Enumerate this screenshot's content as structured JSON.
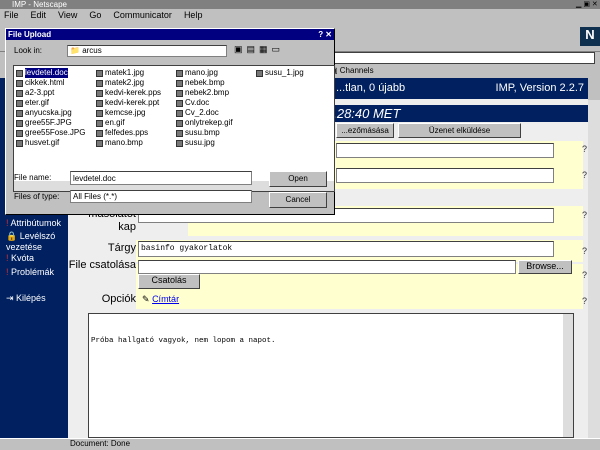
{
  "window": {
    "title": "IMP - Netscape",
    "menu": [
      "File",
      "Edit",
      "View",
      "Go",
      "Communicator",
      "Help"
    ]
  },
  "personal_toolbar": {
    "channels": "Channels"
  },
  "sidebar": {
    "items": [
      "Attribútumok",
      "Levélszó vezetése",
      "Kvóta",
      "Problémák",
      "Kilépés"
    ]
  },
  "header": {
    "status": "...tlan, 0 újabb",
    "version": "IMP, Version 2.2.7",
    "time": "...28:40 MET"
  },
  "buttons": {
    "b1": "...ezőmásása",
    "b2": "Üzenet elküldése"
  },
  "form": {
    "copy_label": "másolatot kap",
    "subject_label": "Tárgy",
    "subject_value": "basinfo gyakorlatok",
    "file_label": "File csatolása",
    "browse": "Browse...",
    "attach": "Csatolás",
    "options_label": "Opciók",
    "options_link": "Címtár",
    "body": "Próba hallgató vagyok, nem lopom a napot."
  },
  "status": {
    "text": "Document: Done"
  },
  "dialog": {
    "title": "File Upload",
    "look_in_label": "Look in:",
    "look_in_value": "arcus",
    "file_name_label": "File name:",
    "file_name_value": "levdetel.doc",
    "file_type_label": "Files of type:",
    "file_type_value": "All Files (*.*)",
    "open": "Open",
    "cancel": "Cancel",
    "files": [
      [
        "levdetel.doc",
        "cikkek.html",
        "a2-3.ppt",
        "eter.gif",
        "anyucska.jpg",
        "gree55F.JPG",
        "gree55Fose.JPG",
        "husvet.gif"
      ],
      [
        "matek1.jpg",
        "matek2.jpg",
        "kedvi-kerek.pps",
        "kedvi-kerek.ppt",
        "kemcse.jpg",
        "en.gif",
        "felfedes.pps",
        "mano.bmp"
      ],
      [
        "mano.jpg",
        "nebek.bmp",
        "nebek2.bmp",
        "Cv.doc",
        "Cv_2.doc",
        "onlytrekep.gif",
        "susu.bmp",
        "susu.jpg"
      ],
      [
        "susu_1.jpg"
      ]
    ]
  }
}
